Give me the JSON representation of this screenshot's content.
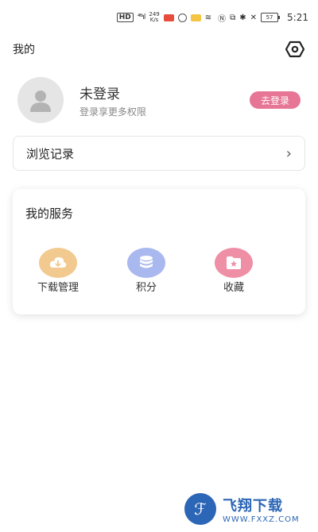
{
  "status_bar": {
    "hd": "HD",
    "signal": "⁴⁶ᶦıl",
    "speed_value": "249",
    "speed_unit": "K/s",
    "battery": "57",
    "time": "5:21"
  },
  "header": {
    "title": "我的",
    "settings_icon": "hexagon-settings-icon"
  },
  "profile": {
    "username": "未登录",
    "subtitle": "登录享更多权限",
    "login_button": "去登录",
    "login_color": "#e77596"
  },
  "history": {
    "label": "浏览记录",
    "chevron": "›"
  },
  "services": {
    "title": "我的服务",
    "items": [
      {
        "label": "下载管理",
        "icon": "download-icon",
        "color": "#f2c98f"
      },
      {
        "label": "积分",
        "icon": "database-icon",
        "color": "#a9b8ef"
      },
      {
        "label": "收藏",
        "icon": "folder-star-icon",
        "color": "#ef8fa6"
      }
    ]
  },
  "watermark": {
    "main": "飞翔下载",
    "sub": "WWW.FXXZ.COM"
  }
}
